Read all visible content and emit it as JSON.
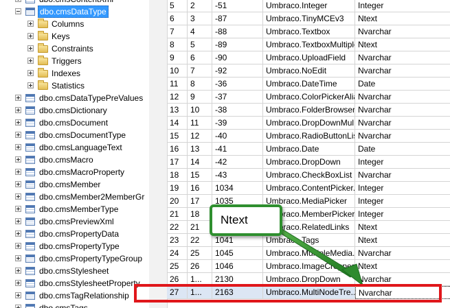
{
  "tree": {
    "top_partial": "dbo.cmsContentXml",
    "selected_table": "dbo.cmsDataType",
    "subfolders": [
      "Columns",
      "Keys",
      "Constraints",
      "Triggers",
      "Indexes",
      "Statistics"
    ],
    "tables": [
      "dbo.cmsDataTypePreValues",
      "dbo.cmsDictionary",
      "dbo.cmsDocument",
      "dbo.cmsDocumentType",
      "dbo.cmsLanguageText",
      "dbo.cmsMacro",
      "dbo.cmsMacroProperty",
      "dbo.cmsMember",
      "dbo.cmsMember2MemberGr",
      "dbo.cmsMemberType",
      "dbo.cmsPreviewXml",
      "dbo.cmsPropertyData",
      "dbo.cmsPropertyType",
      "dbo.cmsPropertyTypeGroup",
      "dbo.cmsStylesheet",
      "dbo.cmsStylesheetProperty",
      "dbo.cmsTagRelationship",
      "dbo.cmsTags"
    ]
  },
  "grid": {
    "rows": [
      [
        "5",
        "2",
        "-51",
        "Umbraco.Integer",
        "Integer"
      ],
      [
        "6",
        "3",
        "-87",
        "Umbraco.TinyMCEv3",
        "Ntext"
      ],
      [
        "7",
        "4",
        "-88",
        "Umbraco.Textbox",
        "Nvarchar"
      ],
      [
        "8",
        "5",
        "-89",
        "Umbraco.TextboxMultiple",
        "Ntext"
      ],
      [
        "9",
        "6",
        "-90",
        "Umbraco.UploadField",
        "Nvarchar"
      ],
      [
        "10",
        "7",
        "-92",
        "Umbraco.NoEdit",
        "Nvarchar"
      ],
      [
        "11",
        "8",
        "-36",
        "Umbraco.DateTime",
        "Date"
      ],
      [
        "12",
        "9",
        "-37",
        "Umbraco.ColorPickerAlias",
        "Nvarchar"
      ],
      [
        "13",
        "10",
        "-38",
        "Umbraco.FolderBrowser",
        "Nvarchar"
      ],
      [
        "14",
        "11",
        "-39",
        "Umbraco.DropDownMul...",
        "Nvarchar"
      ],
      [
        "15",
        "12",
        "-40",
        "Umbraco.RadioButtonList",
        "Nvarchar"
      ],
      [
        "16",
        "13",
        "-41",
        "Umbraco.Date",
        "Date"
      ],
      [
        "17",
        "14",
        "-42",
        "Umbraco.DropDown",
        "Integer"
      ],
      [
        "18",
        "15",
        "-43",
        "Umbraco.CheckBoxList",
        "Nvarchar"
      ],
      [
        "19",
        "16",
        "1034",
        "Umbraco.ContentPicker...",
        "Integer"
      ],
      [
        "20",
        "17",
        "1035",
        "Umbraco.MediaPicker",
        "Integer"
      ],
      [
        "21",
        "18",
        "1036",
        "Umbraco.MemberPicker",
        "Integer"
      ],
      [
        "22",
        "21",
        "1040",
        "Umbraco.RelatedLinks",
        "Ntext"
      ],
      [
        "23",
        "22",
        "1041",
        "Umbraco.Tags",
        "Ntext"
      ],
      [
        "24",
        "25",
        "1045",
        "Umbraco.MultipleMedia...",
        "Nvarchar"
      ],
      [
        "25",
        "26",
        "1046",
        "Umbraco.ImageCropper",
        "Ntext"
      ],
      [
        "26",
        "1...",
        "2130",
        "Umbraco.DropDown",
        "Nvarchar"
      ],
      [
        "27",
        "1...",
        "2163",
        "Umbraco.MultiNodeTre...",
        "Nvarchar"
      ]
    ],
    "selected_row_index": 22
  },
  "callout": {
    "text": "Ntext"
  },
  "colors": {
    "highlight": "#e0171b",
    "callout_border": "#2f8f2f",
    "arrow": "#2e8b2e",
    "tree_selection": "#3399ff"
  }
}
